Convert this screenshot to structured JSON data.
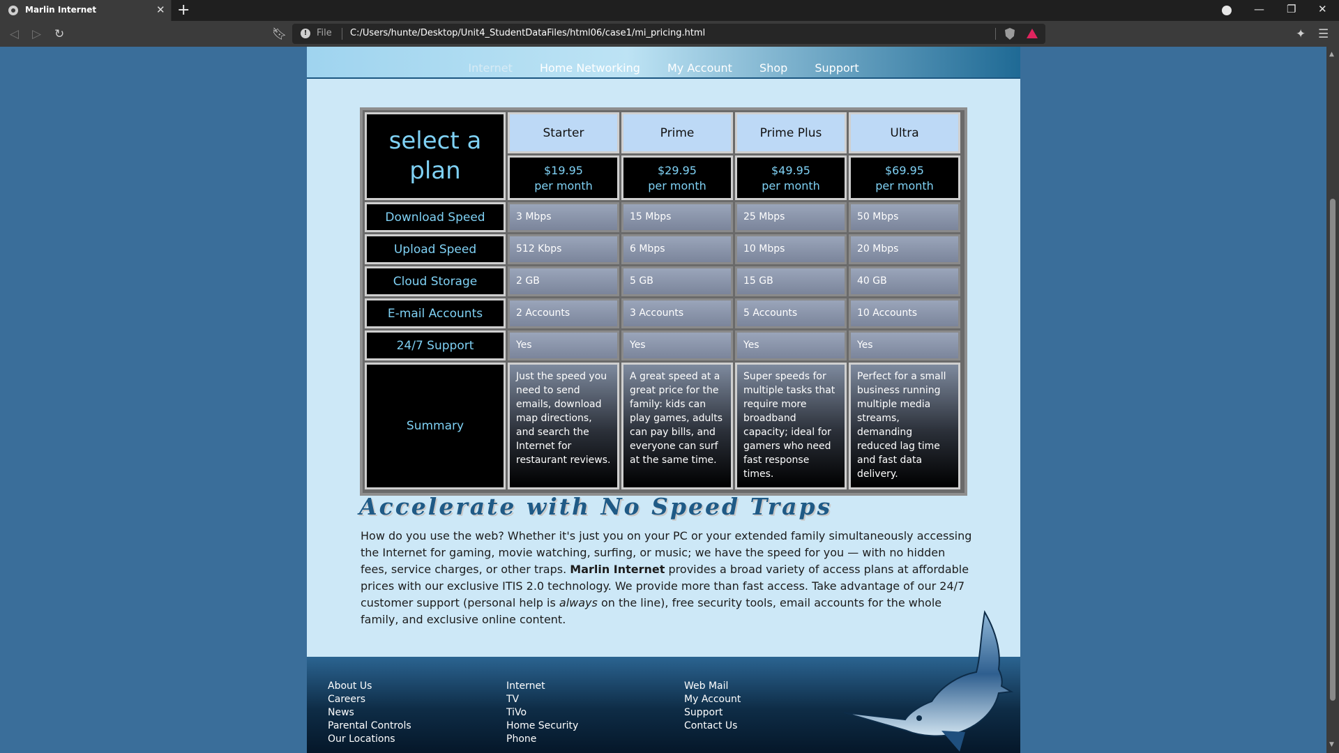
{
  "browser": {
    "tab_title": "Marlin Internet",
    "url_scheme": "File",
    "url": "C:/Users/hunte/Desktop/Unit4_StudentDataFiles/html06/case1/mi_pricing.html"
  },
  "nav": [
    "Internet",
    "Home Networking",
    "My Account",
    "Shop",
    "Support"
  ],
  "pricing": {
    "header_line1": "select a",
    "header_line2": "plan",
    "plans": [
      {
        "name": "Starter",
        "price": "$19.95",
        "period": "per month",
        "download": "3 Mbps",
        "upload": "512 Kbps",
        "storage": "2 GB",
        "email": "2 Accounts",
        "support": "Yes",
        "summary": "Just the speed you need to send emails, download map directions, and search the Internet for restaurant reviews."
      },
      {
        "name": "Prime",
        "price": "$29.95",
        "period": "per month",
        "download": "15 Mbps",
        "upload": "6 Mbps",
        "storage": "5 GB",
        "email": "3 Accounts",
        "support": "Yes",
        "summary": "A great speed at a great price for the family: kids can play games, adults can pay bills, and everyone can surf at the same time."
      },
      {
        "name": "Prime Plus",
        "price": "$49.95",
        "period": "per month",
        "download": "25 Mbps",
        "upload": "10 Mbps",
        "storage": "15 GB",
        "email": "5 Accounts",
        "support": "Yes",
        "summary": "Super speeds for multiple tasks that require more broadband capacity; ideal for gamers who need fast response times."
      },
      {
        "name": "Ultra",
        "price": "$69.95",
        "period": "per month",
        "download": "50 Mbps",
        "upload": "20 Mbps",
        "storage": "40 GB",
        "email": "10 Accounts",
        "support": "Yes",
        "summary": "Perfect for a small business running multiple media streams, demanding reduced lag time and fast data delivery."
      }
    ],
    "row_labels": {
      "download": "Download Speed",
      "upload": "Upload Speed",
      "storage": "Cloud Storage",
      "email": "E-mail Accounts",
      "support": "24/7 Support",
      "summary": "Summary"
    }
  },
  "tagline": "Accelerate with No Speed Traps",
  "intro": {
    "part1": "How do you use the web? Whether it's just you on your PC or your extended family simultaneously accessing the Internet for gaming, movie watching, surfing, or music; we have the speed for you — with no hidden fees, service charges, or other traps. ",
    "brand": "Marlin Internet",
    "part2": " provides a broad variety of access plans at affordable prices with our exclusive ITIS 2.0 technology. We provide more than fast access. Take advantage of our 24/7 customer support (personal help is ",
    "emphasis": "always",
    "part3": " on the line), free security tools, email accounts for the whole family, and exclusive online content."
  },
  "footer": {
    "col1": [
      "About Us",
      "Careers",
      "News",
      "Parental Controls",
      "Our Locations"
    ],
    "col2": [
      "Internet",
      "TV",
      "TiVo",
      "Home Security",
      "Phone"
    ],
    "col3": [
      "Web Mail",
      "My Account",
      "Support",
      "Contact Us"
    ]
  },
  "icons": {
    "tab_close": "close-icon",
    "new_tab": "plus-icon",
    "back": "back-icon",
    "forward": "forward-icon",
    "reload": "reload-icon",
    "bookmark": "bookmark-icon",
    "info": "info-icon",
    "shield": "shield-icon",
    "alert": "alert-icon",
    "extensions": "puzzle-icon",
    "menu": "menu-icon"
  },
  "colors": {
    "accent_cyan": "#7fd1f4",
    "brand_blue": "#1f5a86",
    "page_bg": "#cde8f7",
    "outer_bg": "#3a6e9a"
  }
}
